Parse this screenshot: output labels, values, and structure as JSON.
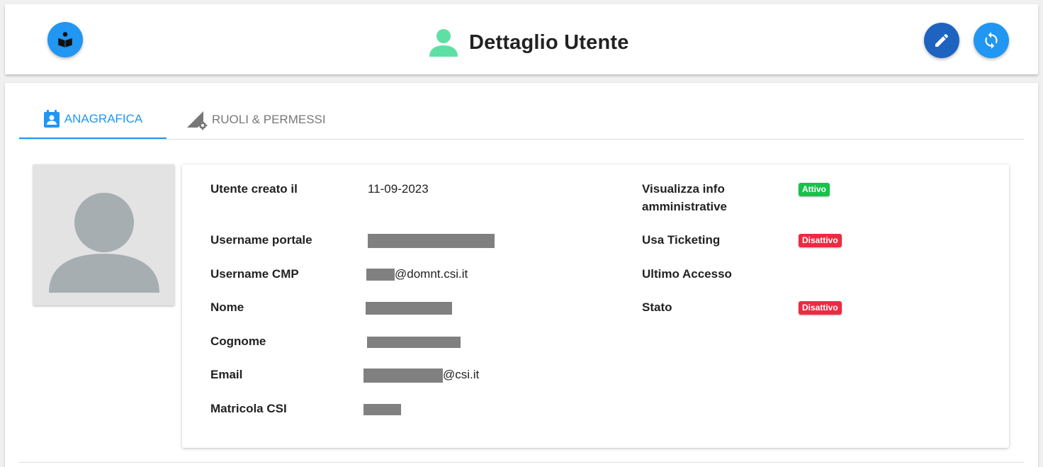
{
  "header": {
    "title": "Dettaglio Utente",
    "icons": {
      "guide": "book-reader-icon",
      "user": "user-icon",
      "edit": "pencil-icon",
      "refresh": "refresh-icon"
    }
  },
  "tabs": [
    {
      "label": "ANAGRAFICA",
      "icon": "contact-card-icon",
      "active": true
    },
    {
      "label": "RUOLI & PERMESSI",
      "icon": "signal-settings-icon",
      "active": false
    }
  ],
  "details": {
    "left": [
      {
        "label": "Utente creato il",
        "value": "11-09-2023"
      },
      {
        "label": "Username portale",
        "value": ""
      },
      {
        "label": "Username CMP",
        "value": "@domnt.csi.it"
      },
      {
        "label": "Nome",
        "value": ""
      },
      {
        "label": "Cognome",
        "value": ""
      },
      {
        "label": "Email",
        "value": "@csi.it"
      },
      {
        "label": "Matricola CSI",
        "value": ""
      }
    ],
    "right": [
      {
        "label": "Visualizza info amministrative",
        "badge": "Attivo"
      },
      {
        "label": "Usa Ticketing",
        "badge": "Disattivo"
      },
      {
        "label": "Ultimo Accesso",
        "badge": ""
      },
      {
        "label": "Stato",
        "badge": "Disattivo"
      }
    ]
  },
  "colors": {
    "primary": "#2196f3",
    "edit": "#1e63bf",
    "user_icon": "#5ee0a4",
    "active": "#17c24a",
    "inactive": "#ee2a43",
    "redacted": "#808080"
  }
}
